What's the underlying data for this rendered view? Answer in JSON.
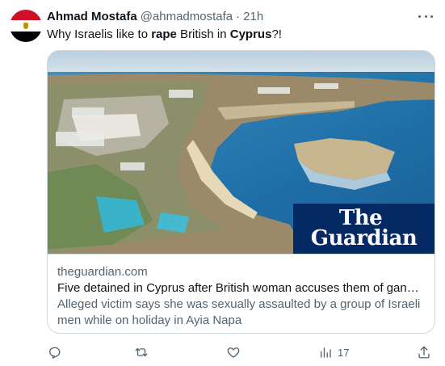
{
  "user": {
    "name": "Ahmad Mostafa",
    "handle": "@ahmadmostafa",
    "separator": "·",
    "time": "21h"
  },
  "tweet": {
    "segments": [
      {
        "text": "Why Israelis like to ",
        "bold": false
      },
      {
        "text": "rape",
        "bold": true
      },
      {
        "text": " British in ",
        "bold": false
      },
      {
        "text": "Cyprus",
        "bold": true
      },
      {
        "text": "?!",
        "bold": false
      }
    ]
  },
  "card": {
    "logo_line1": "The",
    "logo_line2": "Guardian",
    "domain": "theguardian.com",
    "title": "Five detained in Cyprus after British woman accuses them of gang-rape",
    "description": "Alleged victim says she was sexually assaulted by a group of Israeli men while on holiday in Ayia Napa"
  },
  "actions": {
    "views_count": "17"
  },
  "colors": {
    "text_primary": "#0f1419",
    "text_secondary": "#536471",
    "border": "#cfd9de",
    "guardian_blue": "#052962"
  },
  "icons": {
    "reply": "reply-icon",
    "retweet": "retweet-icon",
    "like": "heart-icon",
    "views": "analytics-icon",
    "share": "share-icon",
    "more": "more-icon"
  }
}
